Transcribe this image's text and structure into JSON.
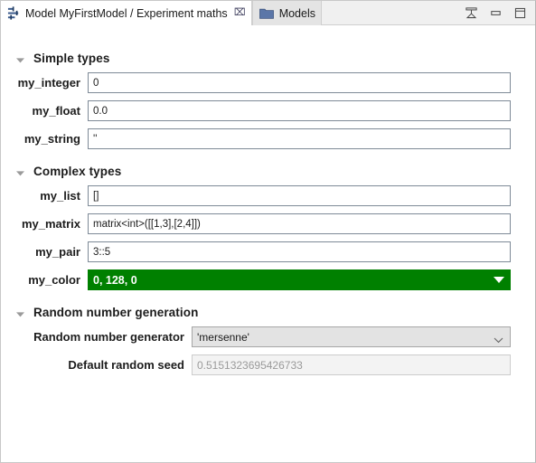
{
  "window": {
    "controls": [
      {
        "name": "restore-view-button",
        "title": "Restore"
      },
      {
        "name": "minimize-button",
        "title": "Minimize"
      },
      {
        "name": "maximize-button",
        "title": "Maximize"
      }
    ]
  },
  "tabs": [
    {
      "label": "Model MyFirstModel / Experiment maths",
      "icon": "sliders-icon",
      "active": true,
      "closable": true,
      "close_glyph": "⌧"
    },
    {
      "label": "Models",
      "icon": "folder-icon",
      "active": false,
      "closable": false
    }
  ],
  "toolbar": {
    "buttons": [
      {
        "name": "revert-button",
        "icon": "back-arrow-icon",
        "color": "#a03a3a"
      },
      {
        "name": "reload-button",
        "icon": "refresh-icon",
        "color": "#3a6ea5"
      },
      {
        "name": "add-button",
        "icon": "plus-icon",
        "color": "#3a6ea5"
      }
    ]
  },
  "sections": [
    {
      "title": "Simple types",
      "expanded": true,
      "rows": [
        {
          "label": "my_integer",
          "value": "0",
          "kind": "text"
        },
        {
          "label": "my_float",
          "value": "0.0",
          "kind": "text"
        },
        {
          "label": "my_string",
          "value": "''",
          "kind": "text"
        }
      ]
    },
    {
      "title": "Complex types",
      "expanded": true,
      "rows": [
        {
          "label": "my_list",
          "value": "[]",
          "kind": "text"
        },
        {
          "label": "my_matrix",
          "value": "matrix<int>([[1,3],[2,4]])",
          "kind": "text"
        },
        {
          "label": "my_pair",
          "value": "3::5",
          "kind": "text"
        },
        {
          "label": "my_color",
          "value": "0, 128, 0",
          "kind": "color",
          "color": "#008000"
        }
      ]
    },
    {
      "title": "Random number generation",
      "expanded": true,
      "rows": [
        {
          "label": "Random number generator",
          "value": "'mersenne'",
          "kind": "combo"
        },
        {
          "label": "Default random seed",
          "value": "0.5151323695426733",
          "kind": "disabled"
        }
      ]
    }
  ]
}
